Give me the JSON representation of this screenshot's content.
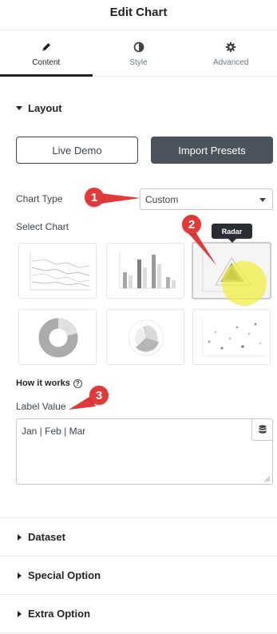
{
  "header": {
    "title": "Edit Chart"
  },
  "tabs": [
    {
      "label": "Content",
      "icon": "pencil-icon",
      "active": true
    },
    {
      "label": "Style",
      "icon": "half-circle-icon",
      "active": false
    },
    {
      "label": "Advanced",
      "icon": "gear-icon",
      "active": false
    }
  ],
  "layout": {
    "title": "Layout",
    "live_demo_label": "Live Demo",
    "import_presets_label": "Import Presets",
    "chart_type_label": "Chart Type",
    "chart_type_value": "Custom",
    "select_chart_label": "Select Chart",
    "chart_options": [
      "line-chart",
      "bar-chart",
      "radar-chart",
      "doughnut-chart",
      "polar-area-chart",
      "bubble-chart"
    ],
    "selected_chart": "radar-chart",
    "tooltip": "Radar",
    "how_it_works": "How it works",
    "label_value_label": "Label Value",
    "label_value": "Jan | Feb | Mar"
  },
  "annotations": [
    "1",
    "2",
    "3"
  ],
  "collapsed_sections": [
    "Dataset",
    "Special Option",
    "Extra Option"
  ],
  "colors": {
    "accent_dark": "#4b535c",
    "annotation_red": "#e23a3a",
    "highlight_yellow": "#f0f03c"
  }
}
